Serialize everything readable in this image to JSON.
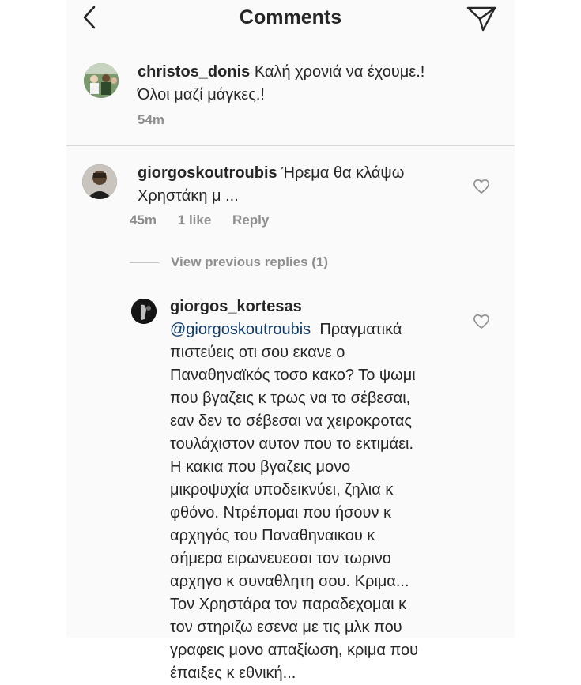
{
  "header": {
    "title": "Comments"
  },
  "caption": {
    "username": "christos_donis",
    "line1": "Καλή χρονιά να έχουμε.!",
    "line2": "Όλοι μαζί μάγκες.!",
    "time": "54m"
  },
  "comment": {
    "username": "giorgoskoutroubis",
    "line1": "Ήρεμα θα κλάψω",
    "line2": "Χρηστάκη μ ...",
    "time": "45m",
    "likes": "1 like",
    "reply_label": "Reply"
  },
  "view_replies": {
    "label": "View previous replies (1)"
  },
  "reply": {
    "username": "giorgos_kortesas",
    "mention": "@giorgoskoutroubis",
    "first_line_rest": "Πραγματικά",
    "lines": [
      "πιστεύεις οτι σου εκανε ο",
      "Παναθηναϊκός τοσο κακο? Το ψωμι",
      "που βγαζεις κ τρως να το σέβεσαι,",
      "εαν δεν το σέβεσαι να χειροκροτας",
      "τουλάχιστον αυτον που το  εκτιμάει.",
      "Η κακια που βγαζεις μονο",
      "μικροψυχία υποδεικνύει, ζηλια κ",
      "φθόνο. Ντρέπομαι που ήσουν κ",
      "αρχηγός του Παναθηναικου κ",
      "σήμερα ειρωνευεσαι τον τωρινο",
      "αρχηγο κ συναθλητη σου. Κριμα...",
      "Τον Χρηστάρα τον παραδεχομαι κ",
      "τον στηριζω εσενα με τις μλκ που",
      "γραφεις μονο απαξίωση, κριμα που",
      "έπαιξες κ εθνική..."
    ]
  },
  "icons": {
    "back": "back-chevron-icon",
    "send": "direct-send-icon",
    "heart": "heart-outline-icon"
  },
  "colors": {
    "text": "#262626",
    "secondary": "#8e8e8e",
    "mention": "#0f3b6d",
    "background": "#fafafa"
  }
}
